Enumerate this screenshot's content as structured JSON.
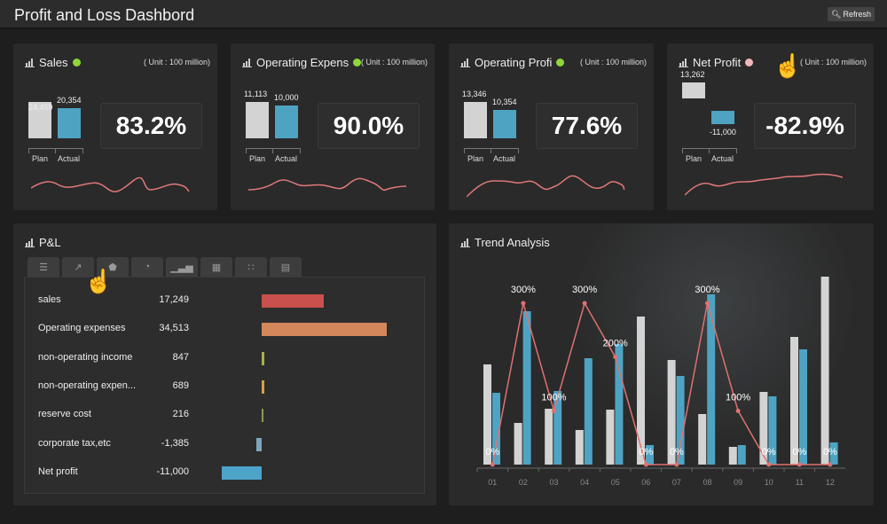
{
  "header": {
    "title": "Profit and Loss Dashbord",
    "refresh_label": "Refresh",
    "refresh_icon": "search-icon"
  },
  "kpis": [
    {
      "title": "Sales",
      "status_color": "#8ed63a",
      "unit": "( Unit : 100 million)",
      "plan": 24459,
      "actual": 20354,
      "plan_label": "24,459",
      "actual_label": "20,354",
      "x_plan": "Plan",
      "x_actual": "Actual",
      "percent": "83.2%"
    },
    {
      "title": "Operating Expens",
      "status_color": "#8ed63a",
      "unit": "( Unit : 100 million)",
      "plan": 11113,
      "actual": 10000,
      "plan_label": "11,113",
      "actual_label": "10,000",
      "x_plan": "Plan",
      "x_actual": "Actual",
      "percent": "90.0%"
    },
    {
      "title": "Operating Profi",
      "status_color": "#8ed63a",
      "unit": "( Unit : 100 million)",
      "plan": 13346,
      "actual": 10354,
      "plan_label": "13,346",
      "actual_label": "10,354",
      "x_plan": "Plan",
      "x_actual": "Actual",
      "percent": "77.6%"
    },
    {
      "title": "Net Profit",
      "status_color": "#f0b8b8",
      "unit": "( Unit : 100 million)",
      "plan": 13262,
      "actual": -11000,
      "plan_label": "13,262",
      "actual_label": "-11,000",
      "x_plan": "Plan",
      "x_actual": "Actual",
      "percent": "-82.9%"
    }
  ],
  "colors": {
    "plan": "#d3d3d3",
    "actual": "#4ea3c2",
    "line": "#e07070"
  },
  "pl": {
    "title": "P&L",
    "tabs": [
      "list-icon",
      "line-chart-icon",
      "radar-icon",
      "pie-icon",
      "bar-chart-icon",
      "grid-icon",
      "scatter-icon",
      "table-icon"
    ],
    "rows": [
      {
        "label": "sales",
        "value": "17,249",
        "num": 17249,
        "color": "#c9504c"
      },
      {
        "label": "Operating expenses",
        "value": "34,513",
        "num": 34513,
        "color": "#d4875a"
      },
      {
        "label": "non-operating income",
        "value": "847",
        "num": 847,
        "color": "#a9b04a"
      },
      {
        "label": "non-operating expen...",
        "value": "689",
        "num": 689,
        "color": "#d4a24a"
      },
      {
        "label": "reserve cost",
        "value": "216",
        "num": 216,
        "color": "#8a9a50"
      },
      {
        "label": "corporate tax,etc",
        "value": "-1,385",
        "num": -1385,
        "color": "#7fa6bd"
      },
      {
        "label": "Net profit",
        "value": "-11,000",
        "num": -11000,
        "color": "#4ea3c8"
      }
    ]
  },
  "trend": {
    "title": "Trend Analysis"
  },
  "chart_data": {
    "type": "bar",
    "categories": [
      "01",
      "02",
      "03",
      "04",
      "05",
      "06",
      "07",
      "08",
      "09",
      "10",
      "11",
      "12"
    ],
    "series": [
      {
        "type": "bar",
        "color": "#d3d3d3",
        "values": [
          113,
          47,
          63,
          39,
          62,
          167,
          118,
          57,
          20,
          82,
          144,
          212
        ]
      },
      {
        "type": "bar",
        "color": "#4ea3c2",
        "values": [
          81,
          173,
          83,
          120,
          136,
          22,
          100,
          192,
          22,
          77,
          130,
          25
        ]
      },
      {
        "type": "line",
        "color": "#e07070",
        "values": [
          0,
          300,
          100,
          300,
          200,
          0,
          0,
          300,
          100,
          0,
          0,
          0
        ],
        "labels": [
          "0%",
          "300%",
          "100%",
          "300%",
          "200%",
          "0%",
          "0%",
          "300%",
          "100%",
          "0%",
          "0%",
          "0%"
        ]
      }
    ],
    "grid": false,
    "legend": "none"
  }
}
